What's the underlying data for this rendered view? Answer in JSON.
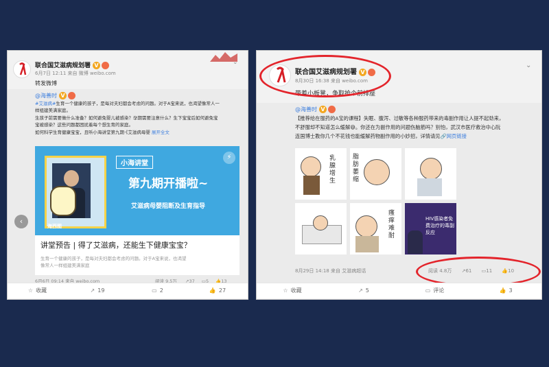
{
  "left": {
    "author": "联合国艾滋病规划署",
    "time": "6月7日 12:11 来自 微博 weibo.com",
    "text": "转发微博",
    "repost": {
      "author": "@海善时",
      "line1_tag": "#艾滋病#",
      "line1": "生育一个健康的孩子，是每对夫妇都会考虑的问题。对于A宝来说，也渴望像常人一",
      "line2": "样组建美满家庭。",
      "line3": "生孩子前需要做什么准备？如何避免婴儿被感染？孕期需要注意什么？生下宝宝后如何避免宝",
      "line4": "宝被感染？这些问题都困扰着每个想生育的家庭。",
      "line5": "如何科学生育健康宝宝，且听小海讲堂第九期·《艾滋病母婴",
      "expand": "展开全文",
      "card_banner": "小海讲堂",
      "card_issue": "第九期开播啦~",
      "card_topic": "艾滋病母婴阻断及生育指导",
      "card_logo": "海西图",
      "card_title": "讲堂预告 | 得了艾滋病，还能生下健康宝宝？",
      "card_desc1": "生育一个健康的孩子，是每对夫妇都会考虑的问题。对于A宝来说，也渴望",
      "card_desc2": "像常人一样组建美满家庭",
      "time": "6月6日 09:14 来自 weibo.com",
      "stats": {
        "reads": "阅读 9.5万",
        "reposts": "37",
        "comments": "5",
        "likes": "13"
      }
    },
    "actions": {
      "fav": "收藏",
      "repost": "19",
      "comment": "2",
      "like": "27"
    }
  },
  "right": {
    "author": "联合国艾滋病规划署",
    "time": "8月30日 16:38 来自 weibo.com",
    "text": "带着小板凳，争取抢个前排座",
    "repost": {
      "author": "@海善时",
      "line1": "【推荐给在服药的A宝的课程】失眠、腹泻、过敏等各种服药带来的毒副作用让人提不起劲来，",
      "line2": "不舒服却不知道怎么缓解",
      "line2b": "。你还在为副作用的问题伤脑筋吗？别怕，武汉市医疗救治中心阮",
      "line3": "连国博士教你几个不花钱也能缓解药物副作用的小妙招，详情请见",
      "link": "网页链接",
      "images": [
        "乳腺增生",
        "脂肪萎缩",
        "",
        "",
        "瘙痒难耐",
        "HIV感染者免费治疗的毒副反应"
      ],
      "time": "8月29日 14:18 来自 艾滋病超话",
      "stats": {
        "reads": "阅读 4.8万",
        "reposts": "61",
        "comments": "11",
        "likes": "10"
      }
    },
    "actions": {
      "fav": "收藏",
      "repost": "5",
      "comment": "评论",
      "like": "3"
    }
  }
}
